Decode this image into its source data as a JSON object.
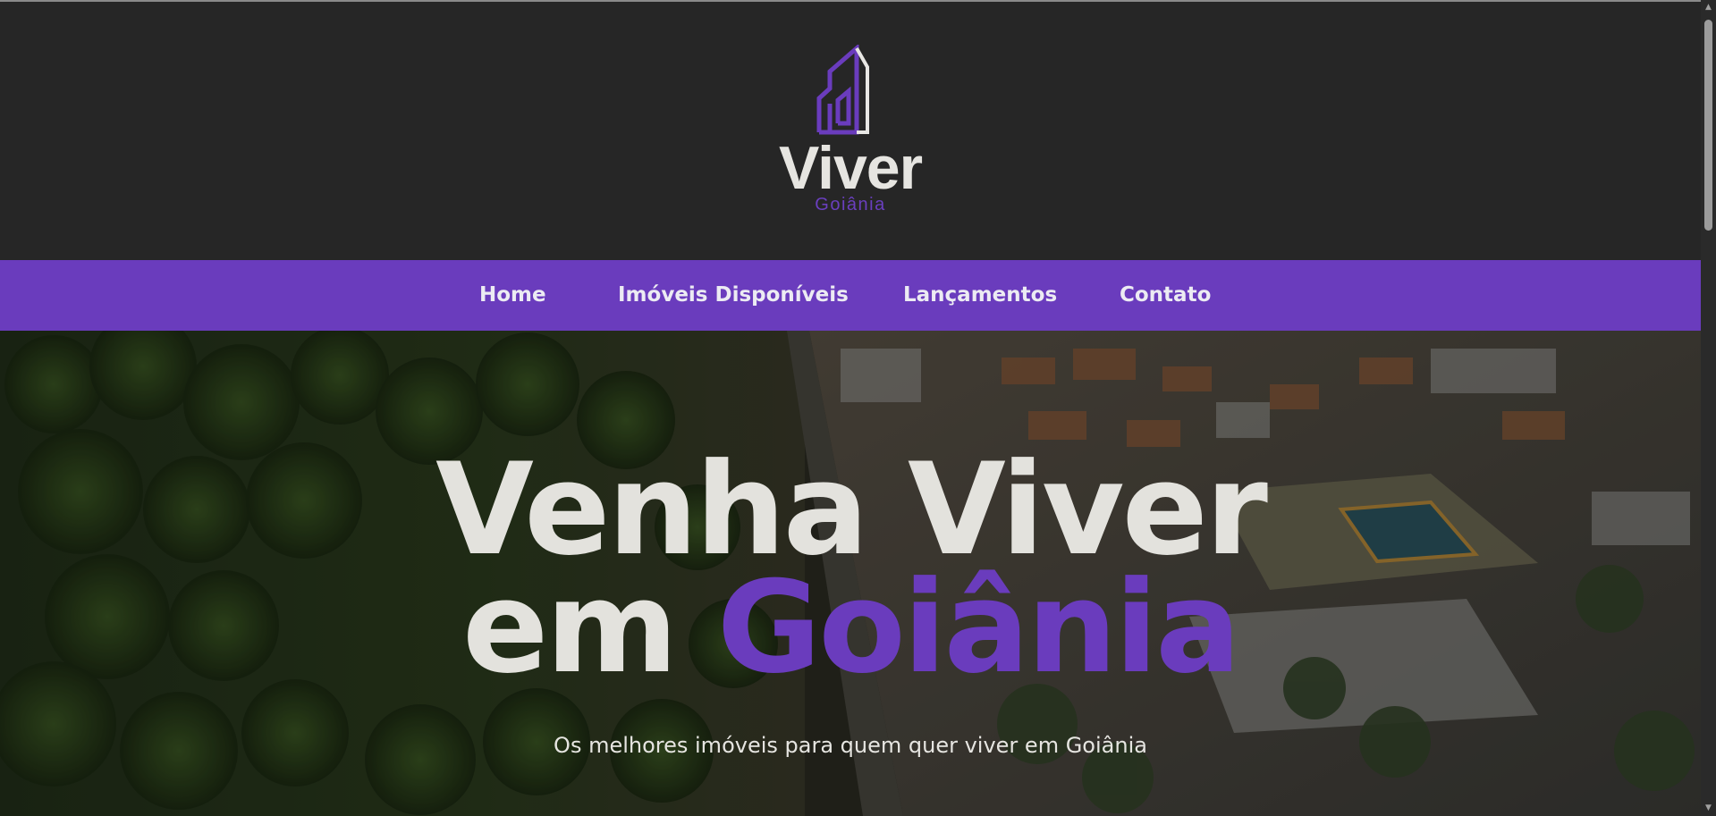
{
  "header": {
    "logo_word": "Viver",
    "logo_sub": "Goiânia",
    "logo_icon": "building-outline-logo"
  },
  "nav": {
    "items": [
      {
        "label": "Home"
      },
      {
        "label": "Imóveis Disponíveis"
      },
      {
        "label": "Lançamentos"
      },
      {
        "label": "Contato"
      }
    ]
  },
  "hero": {
    "title_line1": "Venha Viver",
    "title_line2_prefix": "em",
    "title_line2_accent": "Goiânia",
    "subtitle": "Os melhores imóveis para quem quer viver em Goiânia",
    "background": "aerial-city-photo"
  },
  "colors": {
    "brand_purple": "#6a3cbd",
    "header_bg": "#262626",
    "text_light": "#e6e5e1"
  }
}
